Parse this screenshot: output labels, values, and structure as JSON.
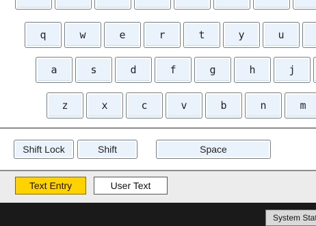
{
  "keyboard": {
    "row_q": [
      "q",
      "w",
      "e",
      "r",
      "t",
      "y",
      "u"
    ],
    "row_a": [
      "a",
      "s",
      "d",
      "f",
      "g",
      "h",
      "j"
    ],
    "row_z": [
      "z",
      "x",
      "c",
      "v",
      "b",
      "n",
      "m"
    ],
    "shift_lock_label": "Shift Lock",
    "shift_label": "Shift",
    "space_label": "Space"
  },
  "tabs": {
    "text_entry_label": "Text Entry",
    "user_text_label": "User Text"
  },
  "footer": {
    "system_status_label": "System Status"
  },
  "colors": {
    "active_tab": "#ffd200",
    "key_face": "#eaf3fb",
    "footer": "#1a1a1a"
  }
}
